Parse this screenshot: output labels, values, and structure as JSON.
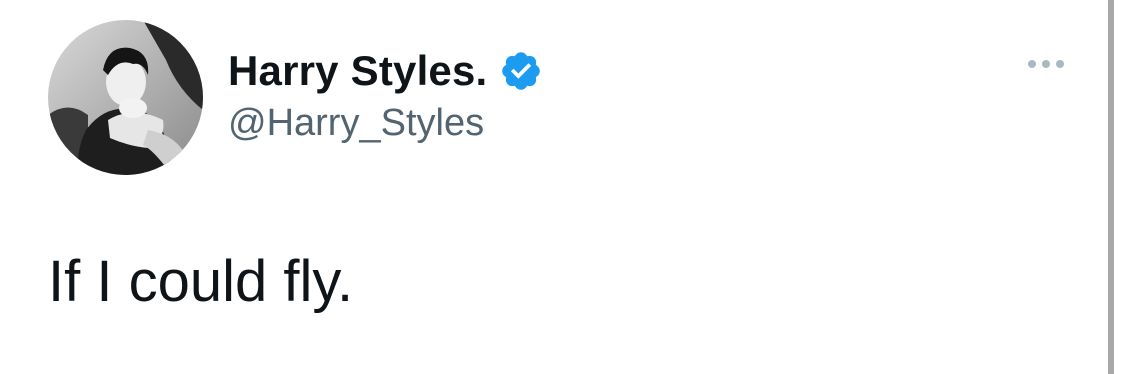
{
  "author": {
    "display_name": "Harry Styles.",
    "handle": "@Harry_Styles",
    "verified": true,
    "avatar_icon": "profile-photo-grayscale"
  },
  "tweet": {
    "text": "If I could fly."
  },
  "menu": {
    "icon": "more-horizontal-icon"
  },
  "colors": {
    "verified_badge": "#1d9bf0",
    "name_text": "#0f1419",
    "handle_text": "#536471",
    "more_dots": "#aab8c2"
  }
}
